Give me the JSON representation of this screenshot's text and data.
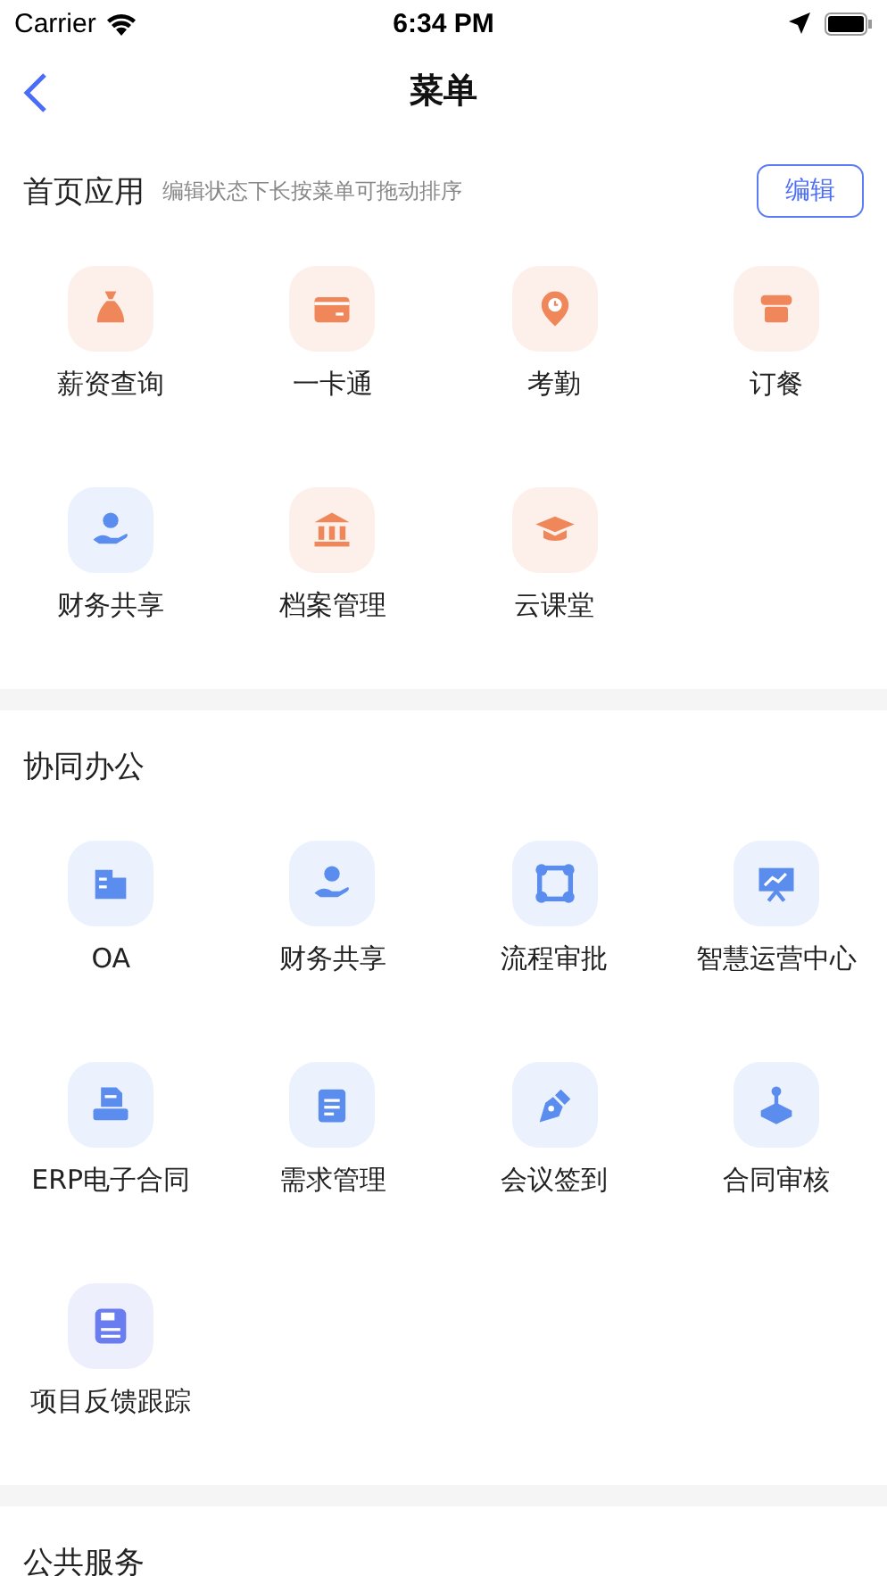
{
  "status_bar": {
    "carrier": "Carrier",
    "time": "6:34 PM"
  },
  "nav": {
    "title": "菜单"
  },
  "sections": [
    {
      "title": "首页应用",
      "hint": "编辑状态下长按菜单可拖动排序",
      "action": "编辑",
      "items": [
        {
          "label": "薪资查询",
          "kind": "moneybag",
          "color": "#f0875a"
        },
        {
          "label": "一卡通",
          "kind": "card",
          "color": "#f0875a"
        },
        {
          "label": "考勤",
          "kind": "clockpin",
          "color": "#f0875a"
        },
        {
          "label": "订餐",
          "kind": "store",
          "color": "#f0875a"
        },
        {
          "label": "财务共享",
          "kind": "handcoin",
          "color": "#5b8def"
        },
        {
          "label": "档案管理",
          "kind": "bank",
          "color": "#f0875a"
        },
        {
          "label": "云课堂",
          "kind": "cap",
          "color": "#f0875a"
        }
      ]
    },
    {
      "title": "协同办公",
      "items": [
        {
          "label": "OA",
          "kind": "building",
          "color": "#5b8def"
        },
        {
          "label": "财务共享",
          "kind": "handcoin",
          "color": "#5b8def"
        },
        {
          "label": "流程审批",
          "kind": "nodes",
          "color": "#5b8def"
        },
        {
          "label": "智慧运营中心",
          "kind": "board",
          "color": "#5b8def"
        },
        {
          "label": "ERP电子合同",
          "kind": "printer",
          "color": "#5b8def"
        },
        {
          "label": "需求管理",
          "kind": "notepad",
          "color": "#5b8def"
        },
        {
          "label": "会议签到",
          "kind": "pen",
          "color": "#5b8def"
        },
        {
          "label": "合同审核",
          "kind": "joystick",
          "color": "#5b8def"
        },
        {
          "label": "项目反馈跟踪",
          "kind": "floppy",
          "color": "#6a7df0"
        }
      ]
    },
    {
      "title": "公共服务"
    }
  ]
}
